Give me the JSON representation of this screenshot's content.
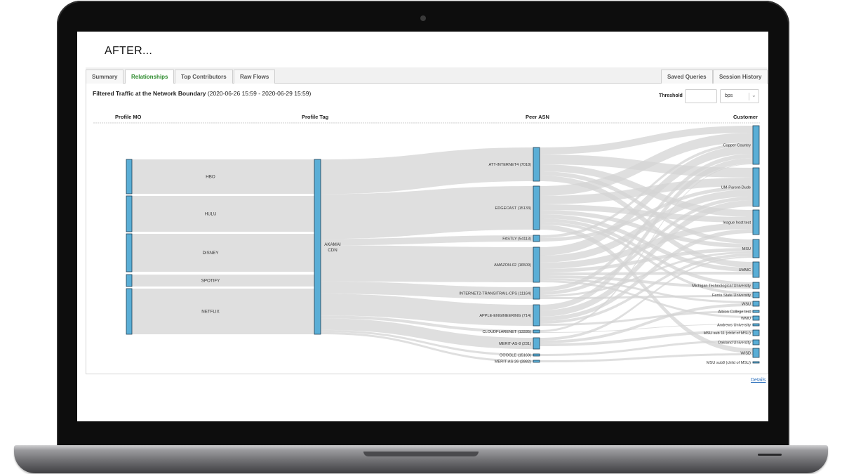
{
  "heading": {
    "title": "AFTER..."
  },
  "tabs": {
    "summary": "Summary",
    "relationships": "Relationships",
    "top_contributors": "Top Contributors",
    "raw_flows": "Raw Flows",
    "saved_queries": "Saved Queries",
    "session_history": "Session History"
  },
  "panel": {
    "title": "Filtered Traffic at the Network Boundary",
    "date_range": "(2020-06-26 15:59 - 2020-06-29 15:59)",
    "threshold_label": "Threshold",
    "threshold_value": "",
    "unit": "bps"
  },
  "sankey": {
    "columns": {
      "profile_mo": "Profile MO",
      "profile_tag": "Profile Tag",
      "peer_asn": "Peer ASN",
      "customer": "Customer"
    },
    "profiles": [
      "HBO",
      "HULU",
      "DISNEY",
      "SPOTIFY",
      "NETFLIX"
    ],
    "tag": {
      "line1": "AKAMAI",
      "line2": "CDN"
    },
    "peer_asns": [
      "ATT-INTERNET4 (7018)",
      "EDGECAST (15133)",
      "FASTLY (54113)",
      "AMAZON-02 (16509)",
      "INTERNET2-TRANSITRAIL-CPS (11164)",
      "APPLE-ENGINEERING (714)",
      "CLOUDFLARENET (13335)",
      "MERIT-AS-8 (231)",
      "GOOGLE (15169)",
      "MERIT-AS-26 (2882)"
    ],
    "customers": [
      "Copper Country",
      "UM-Parent-Dude",
      "league host test",
      "MSU",
      "UMMC",
      "Michigan Technological University",
      "Ferris State University",
      "WSU",
      "Albion College test",
      "WMU",
      "Andrews University",
      "MSU sub 11 (child of MSU)",
      "Oakland University",
      "WISD",
      "MSU sub8 (child of MSU)"
    ]
  },
  "footer": {
    "details": "Details"
  },
  "colors": {
    "node": "#5aaed6",
    "node_border": "#1f3f56",
    "flow": "#d4d4d4",
    "active_tab": "#2e8b2e",
    "link": "#2a6ebb"
  }
}
